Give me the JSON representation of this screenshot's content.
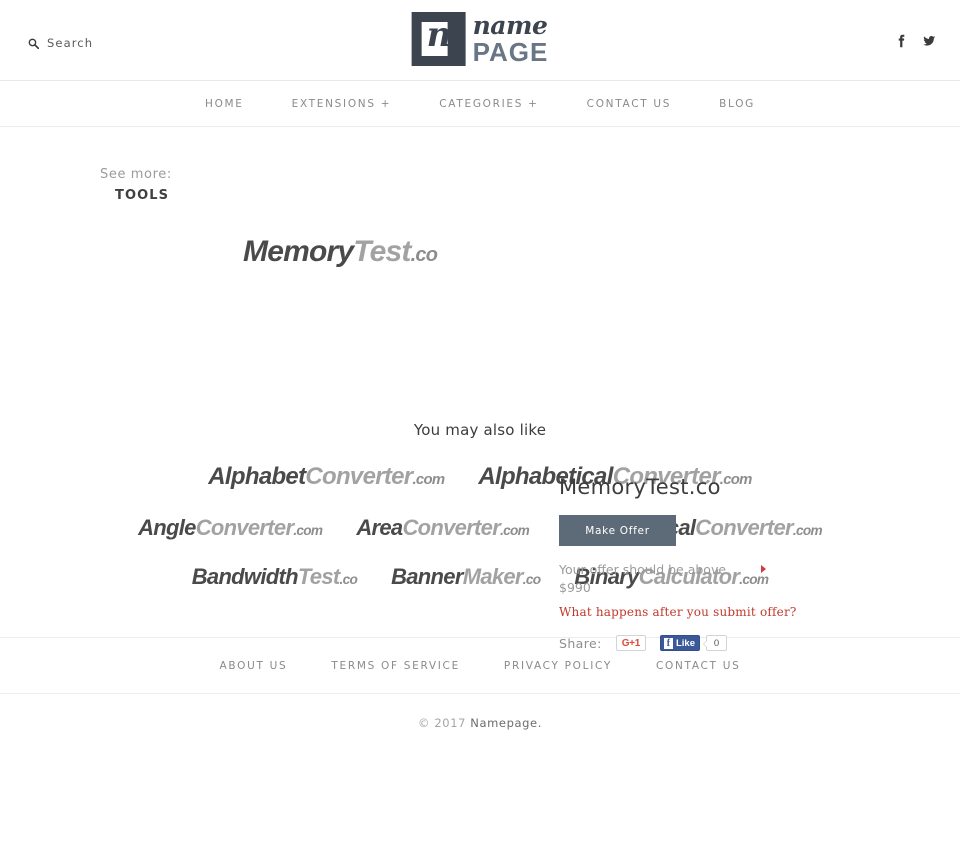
{
  "header": {
    "search": {
      "label": "Search",
      "icon": "search-icon"
    },
    "logo": {
      "mark_letter": "n",
      "name": "name",
      "page": "PAGE"
    },
    "socials": [
      {
        "name": "facebook-icon",
        "label": "f"
      },
      {
        "name": "twitter-icon",
        "label": "t"
      }
    ]
  },
  "nav": {
    "items": [
      {
        "label": "HOME"
      },
      {
        "label": "EXTENSIONS +"
      },
      {
        "label": "CATEGORIES +"
      },
      {
        "label": "CONTACT US"
      },
      {
        "label": "BLOG"
      }
    ]
  },
  "breadcrumb": {
    "see_more_label": "See more:",
    "category": "TOOLS"
  },
  "hero": {
    "domain_part1": "Memory",
    "domain_part2": "Test",
    "domain_tld": ".co"
  },
  "offer": {
    "title": "MemoryTest.co",
    "button_label": "Make Offer",
    "note_line1": "Your offer should be above",
    "note_line2": "$990",
    "info_link": "What happens after you submit offer?",
    "share_label": "Share:",
    "gplus_label": "G+1",
    "facebook_f": "f",
    "facebook_like": "Like",
    "facebook_count": "0",
    "accent_red": "#c0392b",
    "button_color": "#5d6b78"
  },
  "also_like": {
    "title": "You may also like",
    "rows": [
      [
        {
          "part1": "Alphabet",
          "part2": "Converter",
          "tld": ".com"
        },
        {
          "part1": "Alphabetical",
          "part2": "Converter",
          "tld": ".com"
        }
      ],
      [
        {
          "part1": "Angle",
          "part2": "Converter",
          "tld": ".com"
        },
        {
          "part1": "Area",
          "part2": "Converter",
          "tld": ".com"
        },
        {
          "part1": "Astronomical",
          "part2": "Converter",
          "tld": ".com"
        }
      ],
      [
        {
          "part1": "Bandwidth",
          "part2": "Test",
          "tld": ".co"
        },
        {
          "part1": "Banner",
          "part2": "Maker",
          "tld": ".co"
        },
        {
          "part1": "Binary",
          "part2": "Calculator",
          "tld": ".com"
        }
      ]
    ]
  },
  "footer": {
    "links": [
      {
        "label": "ABOUT US"
      },
      {
        "label": "TERMS OF SERVICE"
      },
      {
        "label": "PRIVACY POLICY"
      },
      {
        "label": "CONTACT US"
      }
    ],
    "copyright_prefix": "© 2017 ",
    "copyright_brand": "Namepage."
  }
}
